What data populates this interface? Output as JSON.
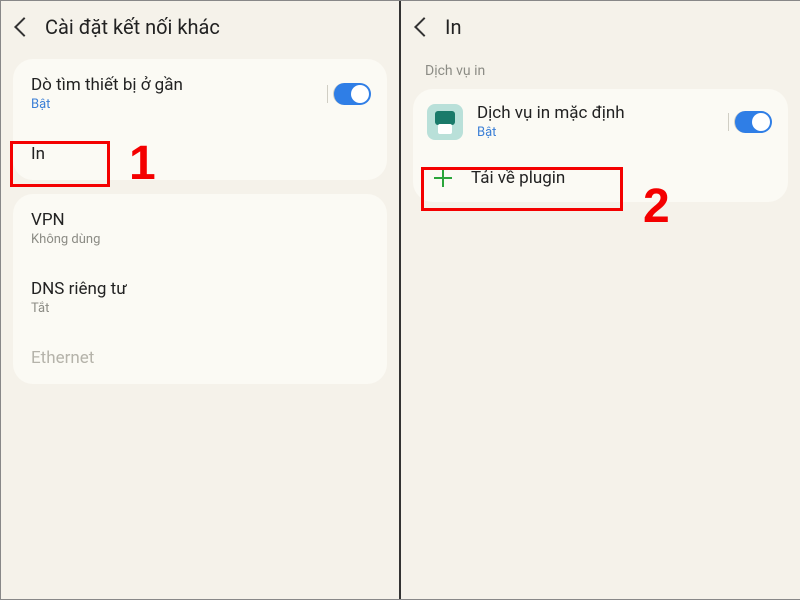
{
  "left": {
    "title": "Cài đặt kết nối khác",
    "nearby": {
      "label": "Dò tìm thiết bị ở gần",
      "status": "Bật"
    },
    "print": {
      "label": "In"
    },
    "vpn": {
      "label": "VPN",
      "status": "Không dùng"
    },
    "dns": {
      "label": "DNS riêng tư",
      "status": "Tắt"
    },
    "ethernet": {
      "label": "Ethernet"
    }
  },
  "right": {
    "title": "In",
    "section": "Dịch vụ in",
    "service": {
      "label": "Dịch vụ in mặc định",
      "status": "Bật"
    },
    "download": {
      "label": "Tải về plugin"
    }
  },
  "annotations": {
    "one": "1",
    "two": "2"
  }
}
